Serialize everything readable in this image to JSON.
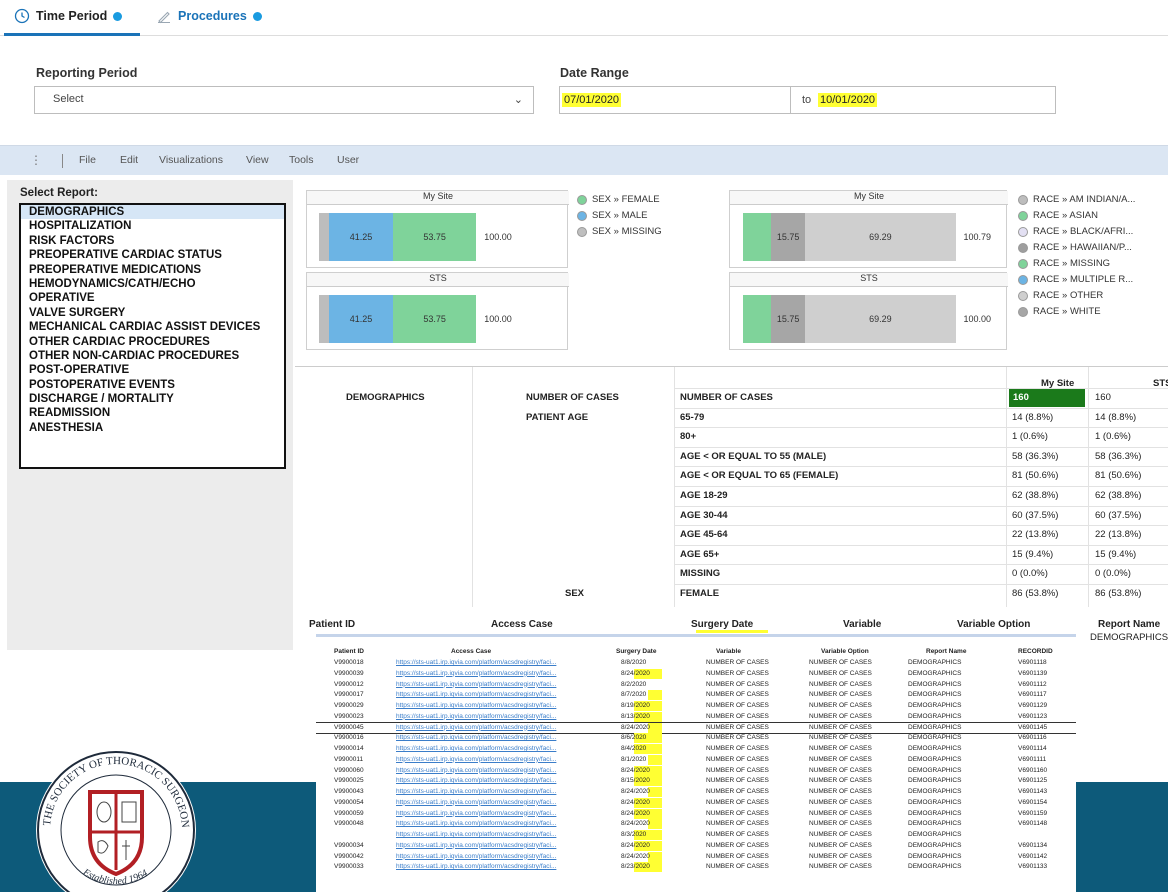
{
  "tabs": [
    {
      "label": "Time Period",
      "icon": "clock-icon",
      "active": true
    },
    {
      "label": "Procedures",
      "icon": "pen-icon",
      "active": false
    }
  ],
  "filters": {
    "reporting_period_label": "Reporting Period",
    "reporting_period_value": "Select",
    "date_range_label": "Date Range",
    "date_from": "07/01/2020",
    "date_to_label": "to",
    "date_to": "10/01/2020"
  },
  "menu": [
    "File",
    "Edit",
    "Visualizations",
    "View",
    "Tools",
    "User"
  ],
  "select_report": {
    "title": "Select Report:",
    "items": [
      "DEMOGRAPHICS",
      "HOSPITALIZATION",
      "RISK FACTORS",
      "PREOPERATIVE CARDIAC STATUS",
      "PREOPERATIVE MEDICATIONS",
      "HEMODYNAMICS/CATH/ECHO",
      "OPERATIVE",
      "VALVE SURGERY",
      "MECHANICAL CARDIAC ASSIST DEVICES",
      "OTHER CARDIAC PROCEDURES",
      "OTHER NON-CARDIAC PROCEDURES",
      "POST-OPERATIVE",
      "POSTOPERATIVE EVENTS",
      "DISCHARGE / MORTALITY",
      "READMISSION",
      "ANESTHESIA"
    ],
    "selected": "DEMOGRAPHICS"
  },
  "sex_chart": {
    "panels": [
      {
        "title": "My Site",
        "segments": [
          {
            "value": 41.25,
            "color": "#6cb4e4"
          },
          {
            "value": 53.75,
            "color": "#7fd39a"
          }
        ],
        "total": "100.00"
      },
      {
        "title": "STS",
        "segments": [
          {
            "value": 41.25,
            "color": "#6cb4e4"
          },
          {
            "value": 53.75,
            "color": "#7fd39a"
          }
        ],
        "total": "100.00"
      }
    ],
    "legend": [
      {
        "label": "SEX » FEMALE",
        "color": "#7fd39a"
      },
      {
        "label": "SEX » MALE",
        "color": "#6cb4e4"
      },
      {
        "label": "SEX » MISSING",
        "color": "#bfbfbf"
      }
    ]
  },
  "race_chart": {
    "panels": [
      {
        "title": "My Site",
        "segments": [
          {
            "value": 15.75,
            "color": "#a6a6a6"
          },
          {
            "value": 69.29,
            "color": "#cfcfcf"
          }
        ],
        "total": "100.79"
      },
      {
        "title": "STS",
        "segments": [
          {
            "value": 15.75,
            "color": "#a6a6a6"
          },
          {
            "value": 69.29,
            "color": "#cfcfcf"
          }
        ],
        "total": "100.00"
      }
    ],
    "legend": [
      {
        "label": "RACE » AM INDIAN/A...",
        "color": "#bdbdbd"
      },
      {
        "label": "RACE » ASIAN",
        "color": "#7fd39a"
      },
      {
        "label": "RACE » BLACK/AFRI...",
        "color": "#e3e0f3"
      },
      {
        "label": "RACE » HAWAIIAN/P...",
        "color": "#9e9e9e"
      },
      {
        "label": "RACE » MISSING",
        "color": "#7fd39a"
      },
      {
        "label": "RACE » MULTIPLE R...",
        "color": "#6cb4e4"
      },
      {
        "label": "RACE » OTHER",
        "color": "#cfcfcf"
      },
      {
        "label": "RACE » WHITE",
        "color": "#a6a6a6"
      }
    ]
  },
  "demographics_table": {
    "col_mysite": "My Site",
    "col_sts": "STS",
    "category": "DEMOGRAPHICS",
    "rows": [
      {
        "group": "NUMBER OF CASES",
        "variable": "NUMBER OF CASES",
        "mysite": "160",
        "sts": "160"
      },
      {
        "group": "PATIENT AGE",
        "variable": "65-79",
        "mysite": "14 (8.8%)",
        "sts": "14 (8.8%)"
      },
      {
        "group": "",
        "variable": "80+",
        "mysite": "1 (0.6%)",
        "sts": "1 (0.6%)"
      },
      {
        "group": "",
        "variable": "AGE < OR EQUAL TO 55 (MALE)",
        "mysite": "58 (36.3%)",
        "sts": "58 (36.3%)"
      },
      {
        "group": "",
        "variable": "AGE < OR EQUAL TO 65 (FEMALE)",
        "mysite": "81 (50.6%)",
        "sts": "81 (50.6%)"
      },
      {
        "group": "",
        "variable": "AGE 18-29",
        "mysite": "62 (38.8%)",
        "sts": "62 (38.8%)"
      },
      {
        "group": "",
        "variable": "AGE 30-44",
        "mysite": "60 (37.5%)",
        "sts": "60 (37.5%)"
      },
      {
        "group": "",
        "variable": "AGE 45-64",
        "mysite": "22 (13.8%)",
        "sts": "22 (13.8%)"
      },
      {
        "group": "",
        "variable": "AGE 65+",
        "mysite": "15 (9.4%)",
        "sts": "15 (9.4%)"
      },
      {
        "group": "",
        "variable": "MISSING",
        "mysite": "0 (0.0%)",
        "sts": "0 (0.0%)"
      },
      {
        "group": "SEX",
        "variable": "FEMALE",
        "mysite": "86 (53.8%)",
        "sts": "86 (53.8%)"
      }
    ]
  },
  "patient_header": {
    "cols": [
      "Patient ID",
      "Access Case",
      "Surgery Date",
      "Variable",
      "Variable Option",
      "Report Name"
    ],
    "report_value": "DEMOGRAPHICS"
  },
  "patient_table": {
    "cols": [
      "Patient ID",
      "Access Case",
      "Surgery Date",
      "Variable",
      "Variable Option",
      "Report Name",
      "RECORDID"
    ],
    "rows": [
      [
        "V9900018",
        "https://sts-uat1.irp.iqvia.com/platform/acsdregistry/faci...",
        "8/8/2020",
        "NUMBER OF CASES",
        "NUMBER OF CASES",
        "DEMOGRAPHICS",
        "V6901118"
      ],
      [
        "V9900039",
        "https://sts-uat1.irp.iqvia.com/platform/acsdregistry/faci...",
        "8/24/2020",
        "NUMBER OF CASES",
        "NUMBER OF CASES",
        "DEMOGRAPHICS",
        "V6901139"
      ],
      [
        "V9900012",
        "https://sts-uat1.irp.iqvia.com/platform/acsdregistry/faci...",
        "8/2/2020",
        "NUMBER OF CASES",
        "NUMBER OF CASES",
        "DEMOGRAPHICS",
        "V6901112"
      ],
      [
        "V9900017",
        "https://sts-uat1.irp.iqvia.com/platform/acsdregistry/faci...",
        "8/7/2020",
        "NUMBER OF CASES",
        "NUMBER OF CASES",
        "DEMOGRAPHICS",
        "V6901117"
      ],
      [
        "V9900029",
        "https://sts-uat1.irp.iqvia.com/platform/acsdregistry/faci...",
        "8/19/2020",
        "NUMBER OF CASES",
        "NUMBER OF CASES",
        "DEMOGRAPHICS",
        "V6901129"
      ],
      [
        "V9900023",
        "https://sts-uat1.irp.iqvia.com/platform/acsdregistry/faci...",
        "8/13/2020",
        "NUMBER OF CASES",
        "NUMBER OF CASES",
        "DEMOGRAPHICS",
        "V6901123"
      ],
      [
        "V9900045",
        "https://sts-uat1.irp.iqvia.com/platform/acsdregistry/faci...",
        "8/24/2020",
        "NUMBER OF CASES",
        "NUMBER OF CASES",
        "DEMOGRAPHICS",
        "V6901145"
      ],
      [
        "V9900016",
        "https://sts-uat1.irp.iqvia.com/platform/acsdregistry/faci...",
        "8/6/2020",
        "NUMBER OF CASES",
        "NUMBER OF CASES",
        "DEMOGRAPHICS",
        "V6901116"
      ],
      [
        "V9900014",
        "https://sts-uat1.irp.iqvia.com/platform/acsdregistry/faci...",
        "8/4/2020",
        "NUMBER OF CASES",
        "NUMBER OF CASES",
        "DEMOGRAPHICS",
        "V6901114"
      ],
      [
        "V9900011",
        "https://sts-uat1.irp.iqvia.com/platform/acsdregistry/faci...",
        "8/1/2020",
        "NUMBER OF CASES",
        "NUMBER OF CASES",
        "DEMOGRAPHICS",
        "V6901111"
      ],
      [
        "V9900060",
        "https://sts-uat1.irp.iqvia.com/platform/acsdregistry/faci...",
        "8/24/2020",
        "NUMBER OF CASES",
        "NUMBER OF CASES",
        "DEMOGRAPHICS",
        "V6901160"
      ],
      [
        "V9900025",
        "https://sts-uat1.irp.iqvia.com/platform/acsdregistry/faci...",
        "8/15/2020",
        "NUMBER OF CASES",
        "NUMBER OF CASES",
        "DEMOGRAPHICS",
        "V6901125"
      ],
      [
        "V9900043",
        "https://sts-uat1.irp.iqvia.com/platform/acsdregistry/faci...",
        "8/24/2020",
        "NUMBER OF CASES",
        "NUMBER OF CASES",
        "DEMOGRAPHICS",
        "V6901143"
      ],
      [
        "V9900054",
        "https://sts-uat1.irp.iqvia.com/platform/acsdregistry/faci...",
        "8/24/2020",
        "NUMBER OF CASES",
        "NUMBER OF CASES",
        "DEMOGRAPHICS",
        "V6901154"
      ],
      [
        "V9900059",
        "https://sts-uat1.irp.iqvia.com/platform/acsdregistry/faci...",
        "8/24/2020",
        "NUMBER OF CASES",
        "NUMBER OF CASES",
        "DEMOGRAPHICS",
        "V6901159"
      ],
      [
        "V9900048",
        "https://sts-uat1.irp.iqvia.com/platform/acsdregistry/faci...",
        "8/24/2020",
        "NUMBER OF CASES",
        "NUMBER OF CASES",
        "DEMOGRAPHICS",
        "V6901148"
      ],
      [
        "",
        "https://sts-uat1.irp.iqvia.com/platform/acsdregistry/faci...",
        "8/3/2020",
        "NUMBER OF CASES",
        "NUMBER OF CASES",
        "DEMOGRAPHICS",
        ""
      ],
      [
        "V9900034",
        "https://sts-uat1.irp.iqvia.com/platform/acsdregistry/faci...",
        "8/24/2020",
        "NUMBER OF CASES",
        "NUMBER OF CASES",
        "DEMOGRAPHICS",
        "V6901134"
      ],
      [
        "V9900042",
        "https://sts-uat1.irp.iqvia.com/platform/acsdregistry/faci...",
        "8/24/2020",
        "NUMBER OF CASES",
        "NUMBER OF CASES",
        "DEMOGRAPHICS",
        "V6901142"
      ],
      [
        "V9900033",
        "https://sts-uat1.irp.iqvia.com/platform/acsdregistry/faci...",
        "8/23/2020",
        "NUMBER OF CASES",
        "NUMBER OF CASES",
        "DEMOGRAPHICS",
        "V6901133"
      ]
    ]
  },
  "logo": {
    "text_top": "THE SOCIETY OF THORACIC SURGEONS",
    "text_bottom": "Established 1964"
  }
}
